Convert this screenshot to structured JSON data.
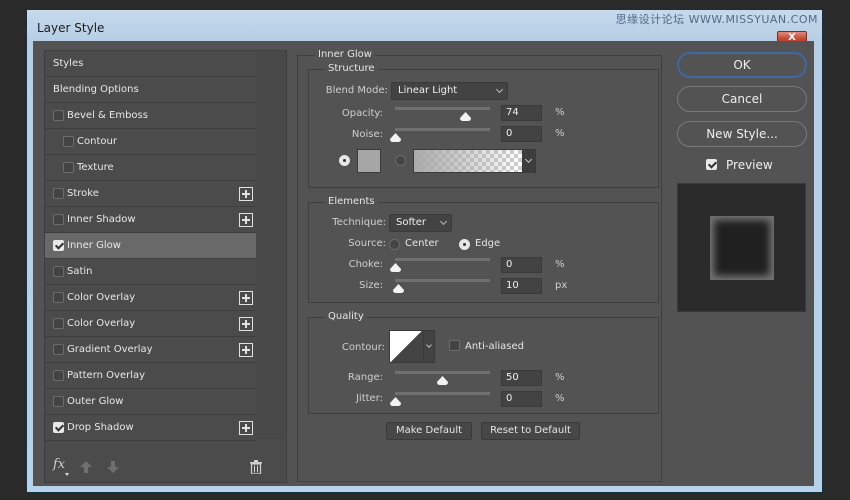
{
  "window": {
    "title": "Layer Style",
    "watermark": "思缘设计论坛 WWW.MISSYUAN.COM",
    "close_label": "X"
  },
  "styles_list": {
    "items": [
      {
        "label": "Styles",
        "checkbox": false,
        "checked": false,
        "indent": 0,
        "plus": false,
        "selected": false
      },
      {
        "label": "Blending Options",
        "checkbox": false,
        "checked": false,
        "indent": 0,
        "plus": false,
        "selected": false
      },
      {
        "label": "Bevel & Emboss",
        "checkbox": true,
        "checked": false,
        "indent": 0,
        "plus": false,
        "selected": false
      },
      {
        "label": "Contour",
        "checkbox": true,
        "checked": false,
        "indent": 1,
        "plus": false,
        "selected": false
      },
      {
        "label": "Texture",
        "checkbox": true,
        "checked": false,
        "indent": 1,
        "plus": false,
        "selected": false
      },
      {
        "label": "Stroke",
        "checkbox": true,
        "checked": false,
        "indent": 0,
        "plus": true,
        "selected": false
      },
      {
        "label": "Inner Shadow",
        "checkbox": true,
        "checked": false,
        "indent": 0,
        "plus": true,
        "selected": false
      },
      {
        "label": "Inner Glow",
        "checkbox": true,
        "checked": true,
        "indent": 0,
        "plus": false,
        "selected": true
      },
      {
        "label": "Satin",
        "checkbox": true,
        "checked": false,
        "indent": 0,
        "plus": false,
        "selected": false
      },
      {
        "label": "Color Overlay",
        "checkbox": true,
        "checked": false,
        "indent": 0,
        "plus": true,
        "selected": false
      },
      {
        "label": "Color Overlay",
        "checkbox": true,
        "checked": false,
        "indent": 0,
        "plus": true,
        "selected": false
      },
      {
        "label": "Gradient Overlay",
        "checkbox": true,
        "checked": false,
        "indent": 0,
        "plus": true,
        "selected": false
      },
      {
        "label": "Pattern Overlay",
        "checkbox": true,
        "checked": false,
        "indent": 0,
        "plus": false,
        "selected": false
      },
      {
        "label": "Outer Glow",
        "checkbox": true,
        "checked": false,
        "indent": 0,
        "plus": false,
        "selected": false
      },
      {
        "label": "Drop Shadow",
        "checkbox": true,
        "checked": true,
        "indent": 0,
        "plus": true,
        "selected": false
      }
    ],
    "footer": {
      "fx_label": "fx",
      "icons": [
        "fx-menu-icon",
        "move-up-icon",
        "move-down-icon",
        "trash-icon"
      ]
    }
  },
  "inner_glow": {
    "section_title": "Inner Glow",
    "structure": {
      "title": "Structure",
      "blend_mode_label": "Blend Mode:",
      "blend_mode_value": "Linear Light",
      "opacity_label": "Opacity:",
      "opacity_value": "74",
      "opacity_unit": "%",
      "opacity_fraction": 0.74,
      "noise_label": "Noise:",
      "noise_value": "0",
      "noise_unit": "%",
      "noise_fraction": 0,
      "color_mode": "solid",
      "color": "#a6a6a6"
    },
    "elements": {
      "title": "Elements",
      "technique_label": "Technique:",
      "technique_value": "Softer",
      "source_label": "Source:",
      "source_center": "Center",
      "source_edge": "Edge",
      "source_selected": "Edge",
      "choke_label": "Choke:",
      "choke_value": "0",
      "choke_unit": "%",
      "choke_fraction": 0,
      "size_label": "Size:",
      "size_value": "10",
      "size_unit": "px",
      "size_fraction": 0.04
    },
    "quality": {
      "title": "Quality",
      "contour_label": "Contour:",
      "anti_aliased_label": "Anti-aliased",
      "anti_aliased": false,
      "range_label": "Range:",
      "range_value": "50",
      "range_unit": "%",
      "range_fraction": 0.5,
      "jitter_label": "Jitter:",
      "jitter_value": "0",
      "jitter_unit": "%",
      "jitter_fraction": 0
    },
    "make_default": "Make Default",
    "reset_default": "Reset to Default"
  },
  "actions": {
    "ok": "OK",
    "cancel": "Cancel",
    "new_style": "New Style...",
    "preview_label": "Preview",
    "preview_checked": true
  }
}
